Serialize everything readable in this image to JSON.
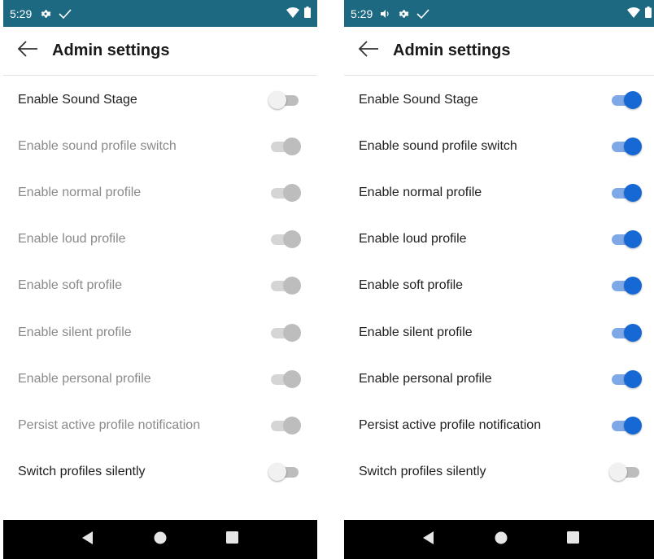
{
  "screens": [
    {
      "status": {
        "time": "5:29",
        "icons": [
          "gear-icon",
          "check-icon"
        ],
        "right_icons": [
          "wifi-icon",
          "battery-icon"
        ]
      },
      "header": {
        "title": "Admin settings"
      },
      "settings": [
        {
          "label": "Enable Sound Stage",
          "state": "off"
        },
        {
          "label": "Enable sound profile switch",
          "state": "disabled"
        },
        {
          "label": "Enable normal profile",
          "state": "disabled"
        },
        {
          "label": "Enable loud profile",
          "state": "disabled"
        },
        {
          "label": "Enable soft profile",
          "state": "disabled"
        },
        {
          "label": "Enable silent profile",
          "state": "disabled"
        },
        {
          "label": "Enable personal profile",
          "state": "disabled"
        },
        {
          "label": "Persist active profile notification",
          "state": "disabled"
        },
        {
          "label": "Switch profiles silently",
          "state": "off"
        }
      ]
    },
    {
      "status": {
        "time": "5:29",
        "icons": [
          "volume-icon",
          "gear-icon",
          "check-icon"
        ],
        "right_icons": [
          "wifi-icon",
          "battery-icon"
        ]
      },
      "header": {
        "title": "Admin settings"
      },
      "settings": [
        {
          "label": "Enable Sound Stage",
          "state": "on"
        },
        {
          "label": "Enable sound profile switch",
          "state": "on"
        },
        {
          "label": "Enable normal profile",
          "state": "on"
        },
        {
          "label": "Enable loud profile",
          "state": "on"
        },
        {
          "label": "Enable soft profile",
          "state": "on"
        },
        {
          "label": "Enable silent profile",
          "state": "on"
        },
        {
          "label": "Enable personal profile",
          "state": "on"
        },
        {
          "label": "Persist active profile notification",
          "state": "on"
        },
        {
          "label": "Switch profiles silently",
          "state": "off"
        }
      ]
    }
  ],
  "colors": {
    "status_bar": "#1d6982",
    "toggle_on": "#1669d4",
    "toggle_on_track": "#7fa9e6",
    "nav_bar": "#000000"
  }
}
